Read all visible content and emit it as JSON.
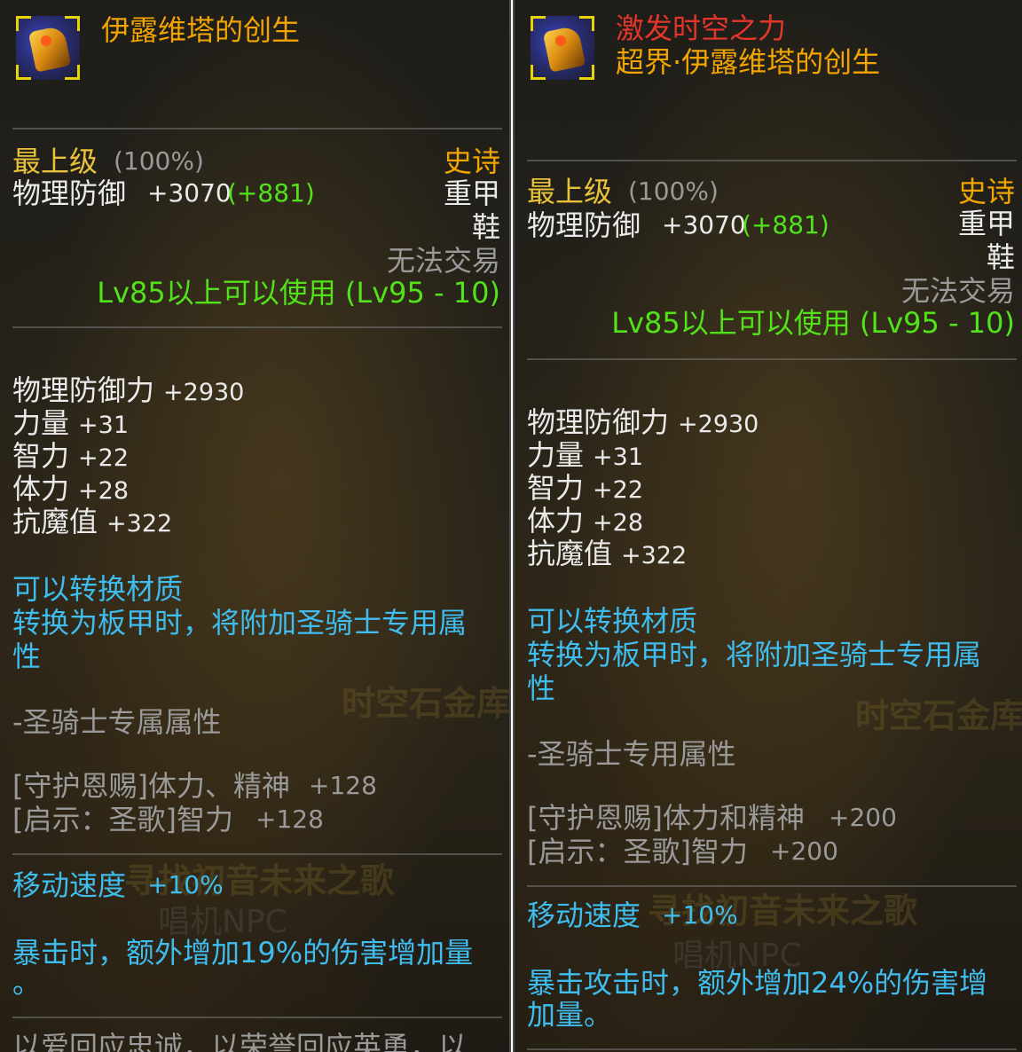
{
  "left": {
    "title": "伊露维塔的创生",
    "grade": "最上级",
    "grade_pct": "(100%)",
    "rarity": "史诗",
    "phys_def_label": "物理防御",
    "phys_def_val": "+3070",
    "phys_def_bonus": "(+881)",
    "armor_type": "重甲",
    "slot": "鞋",
    "trade": "无法交易",
    "level_req": "Lv85以上可以使用 (Lv95 - 10)",
    "stats": [
      {
        "label": "物理防御力",
        "value": "+2930"
      },
      {
        "label": "力量",
        "value": "+31"
      },
      {
        "label": "智力",
        "value": "+22"
      },
      {
        "label": "体力",
        "value": "+28"
      },
      {
        "label": "抗魔值",
        "value": "+322"
      }
    ],
    "convert_1": "可以转换材质",
    "convert_2": "转换为板甲时，将附加圣骑士专用属",
    "convert_3": "性",
    "class_attr": "-圣骑士专属属性",
    "skill_1_label": "[守护恩赐]体力、精神",
    "skill_1_val": "+128",
    "skill_2_label": "[启示：圣歌]智力",
    "skill_2_val": "+128",
    "move_label": "移动速度",
    "move_val": "+10%",
    "crit_1": "暴击时，额外增加19%的伤害增加量",
    "crit_2": "。",
    "bottom_text": "以爱回应忠诚，以荣誉回应英勇，以",
    "wm_1": "时空石金库",
    "wm_2": "寻找初音未来之歌",
    "wm_3": "唱机NPC"
  },
  "right": {
    "title_red": "激发时空之力",
    "title": "超界·伊露维塔的创生",
    "grade": "最上级",
    "grade_pct": "(100%)",
    "rarity": "史诗",
    "phys_def_label": "物理防御",
    "phys_def_val": "+3070",
    "phys_def_bonus": "(+881)",
    "armor_type": "重甲",
    "slot": "鞋",
    "trade": "无法交易",
    "level_req": "Lv85以上可以使用 (Lv95 - 10)",
    "stats": [
      {
        "label": "物理防御力",
        "value": "+2930"
      },
      {
        "label": "力量",
        "value": "+31"
      },
      {
        "label": "智力",
        "value": "+22"
      },
      {
        "label": "体力",
        "value": "+28"
      },
      {
        "label": "抗魔值",
        "value": "+322"
      }
    ],
    "convert_1": "可以转换材质",
    "convert_2": "转换为板甲时，将附加圣骑士专用属",
    "convert_3": "性",
    "class_attr": "-圣骑士专用属性",
    "skill_1_label": "[守护恩赐]体力和精神",
    "skill_1_val": "+200",
    "skill_2_label": "[启示：圣歌]智力",
    "skill_2_val": "+200",
    "move_label": "移动速度",
    "move_val": "+10%",
    "crit_1": "暴击攻击时，额外增加24%的伤害增",
    "crit_2": "加量。",
    "wm_1": "时空石金库",
    "wm_2": "寻找初音未来之歌",
    "wm_3": "唱机NPC"
  }
}
